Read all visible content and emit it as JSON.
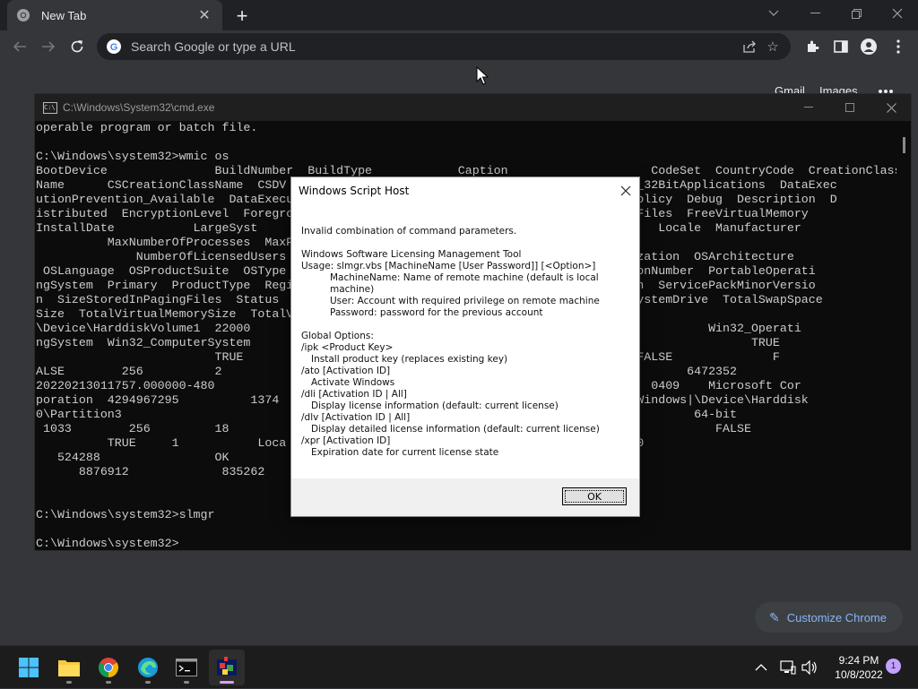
{
  "browser": {
    "tab_title": "New Tab",
    "omnibox_placeholder": "Search Google or type a URL",
    "ntp_links": [
      "Gmail",
      "Images"
    ],
    "customize_label": "Customize Chrome"
  },
  "cmd": {
    "title": "C:\\Windows\\System32\\cmd.exe",
    "lines": [
      "operable program or batch file.",
      "",
      "C:\\Windows\\system32>wmic os",
      "BootDevice               BuildNumber  BuildType            Caption                    CodeSet  CountryCode  CreationClass",
      "Name      CSCreationClassName  CSDV                                         evention_32BitApplications  DataExec",
      "utionPrevention_Available  DataExecu                                        SupportPolicy  Debug  Description  D",
      "istributed  EncryptionLevel  Foregro                                      ceInPagingFiles  FreeVirtualMemory",
      "InstallDate           LargeSyst                                        e               Locale  Manufacturer",
      "          MaxNumberOfProcesses  MaxP",
      "              NumberOfLicensedUsers                                    emSKU  Organization  OSArchitecture",
      " OSLanguage  OSProductSuite  OSType                                        PlusVersionNumber  PortableOperati",
      "ngSystem  Primary  ProductType  Regi                                     MajorVersion  ServicePackMinorVersio",
      "n  SizeStoredInPagingFiles  Status                                       ory       SystemDrive  TotalSwapSpace",
      "Size  TotalVirtualMemorySize  TotalV",
      "\\Device\\HarddiskVolume1  22000                                          1252     1            Win32_Operati",
      "ngSystem  Win32_ComputerSystem                                                                      TRUE",
      "                         TRUE                                                       FALSE              F",
      "ALSE        256          2                                                                 6472352",
      "20220213011757.000000-480                                              00.419000-420  0409    Microsoft Cor",
      "poration  4294967295          1374                                      s 11 Pro|C:\\Windows|\\Device\\Harddisk",
      "0\\Partition3                                                                                64-bit",
      " 1033        256         18                                                                    FALSE",
      "          TRUE     1           Loca                                                 0",
      "   524288                OK                                             ystem32  C:",
      "      8876912             835262",
      "",
      "",
      "C:\\Windows\\system32>slmgr",
      "",
      "C:\\Windows\\system32>"
    ]
  },
  "dialog": {
    "title": "Windows Script Host",
    "lines": [
      {
        "text": "Invalid combination of command parameters.",
        "indent": 0
      },
      {
        "text": "",
        "indent": 0
      },
      {
        "text": "Windows Software Licensing Management Tool",
        "indent": 0
      },
      {
        "text": "Usage: slmgr.vbs [MachineName [User Password]] [<Option>]",
        "indent": 0
      },
      {
        "text": "MachineName: Name of remote machine (default is local machine)",
        "indent": 32
      },
      {
        "text": "User:        Account with required privilege on remote machine",
        "indent": 32
      },
      {
        "text": "Password:    password for the previous account",
        "indent": 32
      },
      {
        "text": "",
        "indent": 0
      },
      {
        "text": "Global Options:",
        "indent": 0
      },
      {
        "text": "/ipk <Product Key>",
        "indent": 0
      },
      {
        "text": "Install product key (replaces existing key)",
        "indent": 11
      },
      {
        "text": "/ato [Activation ID]",
        "indent": 0
      },
      {
        "text": "Activate Windows",
        "indent": 11
      },
      {
        "text": "/dli [Activation ID | All]",
        "indent": 0
      },
      {
        "text": "Display license information (default: current license)",
        "indent": 11
      },
      {
        "text": "/dlv [Activation ID | All]",
        "indent": 0
      },
      {
        "text": "Display detailed license information (default: current license)",
        "indent": 11
      },
      {
        "text": "/xpr [Activation ID]",
        "indent": 0
      },
      {
        "text": "Expiration date for current license state",
        "indent": 11
      }
    ],
    "ok_label": "OK"
  },
  "taskbar": {
    "apps": [
      "start",
      "file-explorer",
      "chrome",
      "edge",
      "terminal",
      "script-host"
    ],
    "time": "9:24 PM",
    "date": "10/8/2022",
    "notification_count": "1"
  }
}
